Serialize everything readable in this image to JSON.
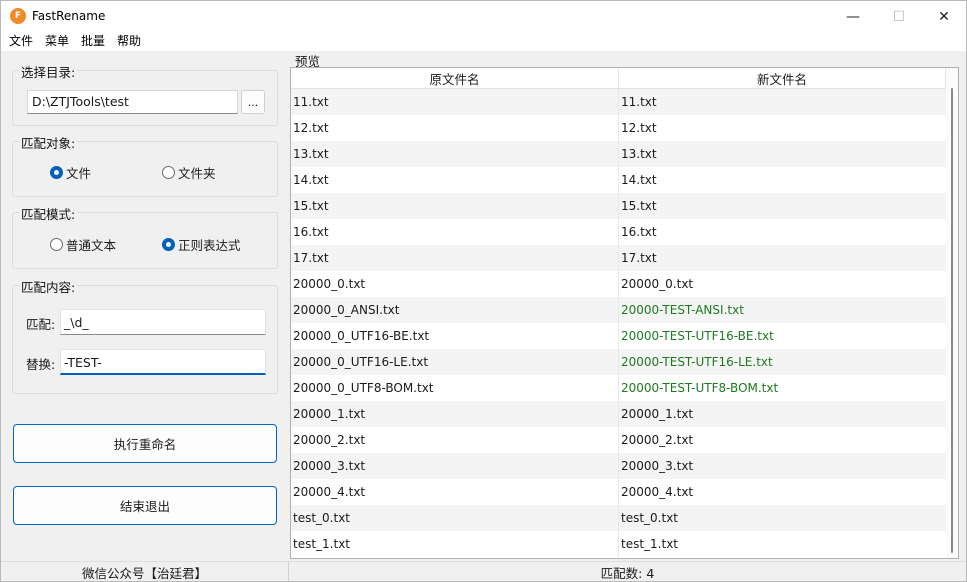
{
  "window": {
    "title": "FastRename",
    "icon": "app-logo-icon",
    "controls": {
      "minimize": "—",
      "maximize": "☐",
      "close": "✕"
    }
  },
  "menu": [
    "文件",
    "菜单",
    "批量",
    "帮助"
  ],
  "directory": {
    "label": "选择目录:",
    "value": "D:\\ZTJTools\\test",
    "browse_label": "..."
  },
  "match_target": {
    "label": "匹配对象:",
    "options": [
      {
        "label": "文件",
        "checked": true
      },
      {
        "label": "文件夹",
        "checked": false
      }
    ]
  },
  "match_mode": {
    "label": "匹配模式:",
    "options": [
      {
        "label": "普通文本",
        "checked": false
      },
      {
        "label": "正则表达式",
        "checked": true
      }
    ]
  },
  "match_content": {
    "label": "匹配内容:",
    "match_label": "匹配:",
    "match_value": "_\\d_",
    "replace_label": "替换:",
    "replace_value": "-TEST-"
  },
  "buttons": {
    "execute": "执行重命名",
    "exit": "结束退出"
  },
  "preview": {
    "label": "预览",
    "columns": [
      "原文件名",
      "新文件名"
    ],
    "rows": [
      {
        "original": "11.txt",
        "renamed": "11.txt",
        "changed": false
      },
      {
        "original": "12.txt",
        "renamed": "12.txt",
        "changed": false
      },
      {
        "original": "13.txt",
        "renamed": "13.txt",
        "changed": false
      },
      {
        "original": "14.txt",
        "renamed": "14.txt",
        "changed": false
      },
      {
        "original": "15.txt",
        "renamed": "15.txt",
        "changed": false
      },
      {
        "original": "16.txt",
        "renamed": "16.txt",
        "changed": false
      },
      {
        "original": "17.txt",
        "renamed": "17.txt",
        "changed": false
      },
      {
        "original": "20000_0.txt",
        "renamed": "20000_0.txt",
        "changed": false
      },
      {
        "original": "20000_0_ANSI.txt",
        "renamed": "20000-TEST-ANSI.txt",
        "changed": true
      },
      {
        "original": "20000_0_UTF16-BE.txt",
        "renamed": "20000-TEST-UTF16-BE.txt",
        "changed": true
      },
      {
        "original": "20000_0_UTF16-LE.txt",
        "renamed": "20000-TEST-UTF16-LE.txt",
        "changed": true
      },
      {
        "original": "20000_0_UTF8-BOM.txt",
        "renamed": "20000-TEST-UTF8-BOM.txt",
        "changed": true
      },
      {
        "original": "20000_1.txt",
        "renamed": "20000_1.txt",
        "changed": false
      },
      {
        "original": "20000_2.txt",
        "renamed": "20000_2.txt",
        "changed": false
      },
      {
        "original": "20000_3.txt",
        "renamed": "20000_3.txt",
        "changed": false
      },
      {
        "original": "20000_4.txt",
        "renamed": "20000_4.txt",
        "changed": false
      },
      {
        "original": "test_0.txt",
        "renamed": "test_0.txt",
        "changed": false
      },
      {
        "original": "test_1.txt",
        "renamed": "test_1.txt",
        "changed": false
      }
    ]
  },
  "status": {
    "left": "微信公众号【治廷君】",
    "right": "匹配数: 4"
  },
  "colors": {
    "accent": "#005fb8",
    "changed_text": "#1f7a1f",
    "app_icon": "#f08a24"
  }
}
